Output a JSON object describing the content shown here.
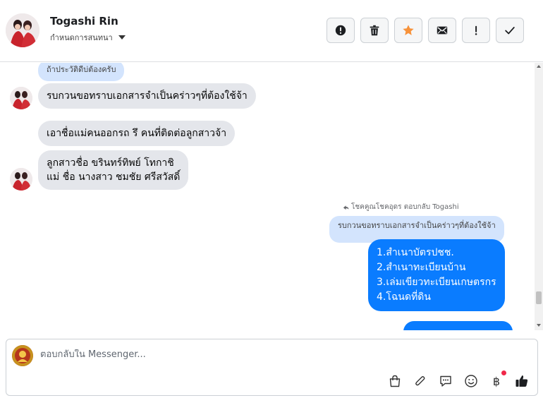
{
  "header": {
    "name": "Togashi Rin",
    "subtitle": "กำหนดการสนทนา",
    "toolbar": [
      {
        "icon": "alert-icon",
        "name": "spam-button"
      },
      {
        "icon": "trash-icon",
        "name": "delete-button"
      },
      {
        "icon": "star-icon",
        "name": "star-button"
      },
      {
        "icon": "mail-icon",
        "name": "mark-unread-button"
      },
      {
        "icon": "exclamation-icon",
        "name": "follow-up-button"
      },
      {
        "icon": "check-icon",
        "name": "done-button"
      }
    ]
  },
  "messages": {
    "top_quote": "ถ้าประวัติดีบ่ต้องครับ",
    "in_1": "รบกวนขอทราบเอกสารจำเป็นคร่าวๆที่ต้องใช้จ้า",
    "in_2": "เอาชื่อแม่คนออกรถ รึ คนที่ติดต่อลูกสาวจ้า",
    "in_3_line1": "ลูกสาวชื่อ ขรินทร์ทิพย์ โทกาชิ",
    "in_3_line2": "แม่ ชื่อ นางสาว ชมชัย ศรีสวัสดิ์",
    "reply_label": "โชคคูณโชคอุดร ตอบกลับ Togashi",
    "reply_quote": "รบกวนขอทราบเอกสารจำเป็นคร่าวๆที่ต้องใช้จ้า",
    "out_1_lines": [
      "1.สำเนาบัตรปชช.",
      "2.สำเนาทะเบียนบ้าน",
      "3.เล่มเขียวทะเบียนเกษตรกร",
      "4.โฉนดที่ดิน"
    ]
  },
  "composer": {
    "placeholder": "ตอบกลับใน Messenger...",
    "tools": [
      "bag-icon",
      "attachment-icon",
      "saved-reply-icon",
      "emoji-icon",
      "baht-icon",
      "like-icon"
    ],
    "baht_symbol": "฿"
  },
  "colors": {
    "outgoing": "#0a7cff",
    "incoming": "#e4e6eb",
    "quote": "#d3e4fd",
    "star": "#f7923a",
    "notification_dot": "#f02849"
  }
}
